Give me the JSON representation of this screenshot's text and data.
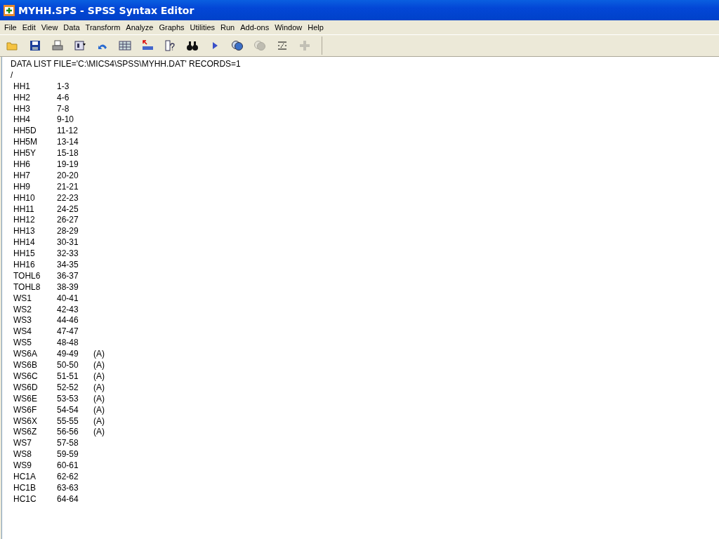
{
  "window": {
    "title": "MYHH.SPS - SPSS Syntax Editor"
  },
  "menu": [
    "File",
    "Edit",
    "View",
    "Data",
    "Transform",
    "Analyze",
    "Graphs",
    "Utilities",
    "Run",
    "Add-ons",
    "Window",
    "Help"
  ],
  "toolbar": [
    {
      "kind": "open",
      "disabled": false
    },
    {
      "kind": "save",
      "disabled": false
    },
    {
      "kind": "print",
      "disabled": false
    },
    {
      "kind": "dialog",
      "disabled": false
    },
    {
      "kind": "undo",
      "disabled": false
    },
    {
      "kind": "grid",
      "disabled": false
    },
    {
      "kind": "goto",
      "disabled": false
    },
    {
      "kind": "variables",
      "disabled": false
    },
    {
      "kind": "find",
      "disabled": false
    },
    {
      "kind": "run",
      "disabled": false
    },
    {
      "kind": "sets",
      "disabled": false
    },
    {
      "kind": "sets",
      "disabled": true
    },
    {
      "kind": "syntax",
      "disabled": false
    },
    {
      "kind": "plus",
      "disabled": true
    }
  ],
  "syntax_lines": [
    {
      "kind": "text",
      "text": "DATA LIST FILE='C:\\MICS4\\SPSS\\MYHH.DAT' RECORDS=1"
    },
    {
      "kind": "text",
      "text": "/"
    },
    {
      "kind": "variable",
      "name": "HH1",
      "columns": "1-3"
    },
    {
      "kind": "variable",
      "name": "HH2",
      "columns": "4-6"
    },
    {
      "kind": "variable",
      "name": "HH3",
      "columns": "7-8"
    },
    {
      "kind": "variable",
      "name": "HH4",
      "columns": "9-10"
    },
    {
      "kind": "variable",
      "name": "HH5D",
      "columns": "11-12"
    },
    {
      "kind": "variable",
      "name": "HH5M",
      "columns": "13-14"
    },
    {
      "kind": "variable",
      "name": "HH5Y",
      "columns": "15-18"
    },
    {
      "kind": "variable",
      "name": "HH6",
      "columns": "19-19"
    },
    {
      "kind": "variable",
      "name": "HH7",
      "columns": "20-20"
    },
    {
      "kind": "variable",
      "name": "HH9",
      "columns": "21-21"
    },
    {
      "kind": "variable",
      "name": "HH10",
      "columns": "22-23"
    },
    {
      "kind": "variable",
      "name": "HH11",
      "columns": "24-25"
    },
    {
      "kind": "variable",
      "name": "HH12",
      "columns": "26-27"
    },
    {
      "kind": "variable",
      "name": "HH13",
      "columns": "28-29"
    },
    {
      "kind": "variable",
      "name": "HH14",
      "columns": "30-31"
    },
    {
      "kind": "variable",
      "name": "HH15",
      "columns": "32-33"
    },
    {
      "kind": "variable",
      "name": "HH16",
      "columns": "34-35"
    },
    {
      "kind": "variable",
      "name": "TOHL6",
      "columns": "36-37"
    },
    {
      "kind": "variable",
      "name": "TOHL8",
      "columns": "38-39"
    },
    {
      "kind": "variable",
      "name": "WS1",
      "columns": "40-41"
    },
    {
      "kind": "variable",
      "name": "WS2",
      "columns": "42-43"
    },
    {
      "kind": "variable",
      "name": "WS3",
      "columns": "44-46"
    },
    {
      "kind": "variable",
      "name": "WS4",
      "columns": "47-47"
    },
    {
      "kind": "variable",
      "name": "WS5",
      "columns": "48-48"
    },
    {
      "kind": "variable",
      "name": "WS6A",
      "columns": "49-49",
      "format": "(A)"
    },
    {
      "kind": "variable",
      "name": "WS6B",
      "columns": "50-50",
      "format": "(A)"
    },
    {
      "kind": "variable",
      "name": "WS6C",
      "columns": "51-51",
      "format": "(A)"
    },
    {
      "kind": "variable",
      "name": "WS6D",
      "columns": "52-52",
      "format": "(A)"
    },
    {
      "kind": "variable",
      "name": "WS6E",
      "columns": "53-53",
      "format": "(A)"
    },
    {
      "kind": "variable",
      "name": "WS6F",
      "columns": "54-54",
      "format": "(A)"
    },
    {
      "kind": "variable",
      "name": "WS6X",
      "columns": "55-55",
      "format": "(A)"
    },
    {
      "kind": "variable",
      "name": "WS6Z",
      "columns": "56-56",
      "format": "(A)"
    },
    {
      "kind": "variable",
      "name": "WS7",
      "columns": "57-58"
    },
    {
      "kind": "variable",
      "name": "WS8",
      "columns": "59-59"
    },
    {
      "kind": "variable",
      "name": "WS9",
      "columns": "60-61"
    },
    {
      "kind": "variable",
      "name": "HC1A",
      "columns": "62-62"
    },
    {
      "kind": "variable",
      "name": "HC1B",
      "columns": "63-63"
    },
    {
      "kind": "variable",
      "name": "HC1C",
      "columns": "64-64"
    }
  ]
}
